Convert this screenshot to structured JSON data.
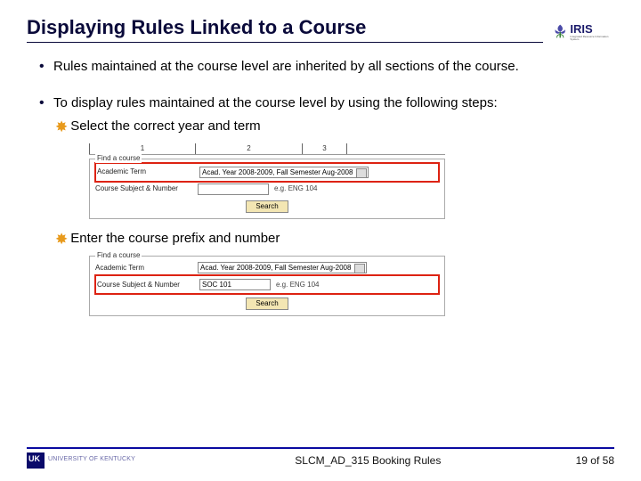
{
  "header": {
    "title": "Displaying Rules Linked to a Course",
    "logo_text": "IRIS",
    "logo_sub": "Integrated Resource Information System"
  },
  "bullets": {
    "b1": "Rules maintained at the course level are inherited by all sections of the course.",
    "b2": "To display rules maintained at the course level by using the following steps:",
    "sub1": "Select the correct year and term",
    "sub2": "Enter the course prefix and number"
  },
  "form1": {
    "tabs": {
      "t1": "1",
      "t2": "2",
      "t3": "3"
    },
    "legend": "Find a course",
    "row_term_label": "Academic Term",
    "row_term_value": "Acad. Year 2008-2009, Fall Semester Aug-2008",
    "row_subject_label": "Course Subject & Number",
    "row_subject_value": "",
    "hint": "e.g. ENG 104",
    "search": "Search"
  },
  "form2": {
    "legend": "Find a course",
    "row_term_label": "Academic Term",
    "row_term_value": "Acad. Year 2008-2009, Fall Semester Aug-2008",
    "row_subject_label": "Course Subject & Number",
    "row_subject_value": "SOC 101",
    "hint": "e.g. ENG 104",
    "search": "Search"
  },
  "footer": {
    "center": "SLCM_AD_315 Booking Rules",
    "page": "19 of 58"
  }
}
